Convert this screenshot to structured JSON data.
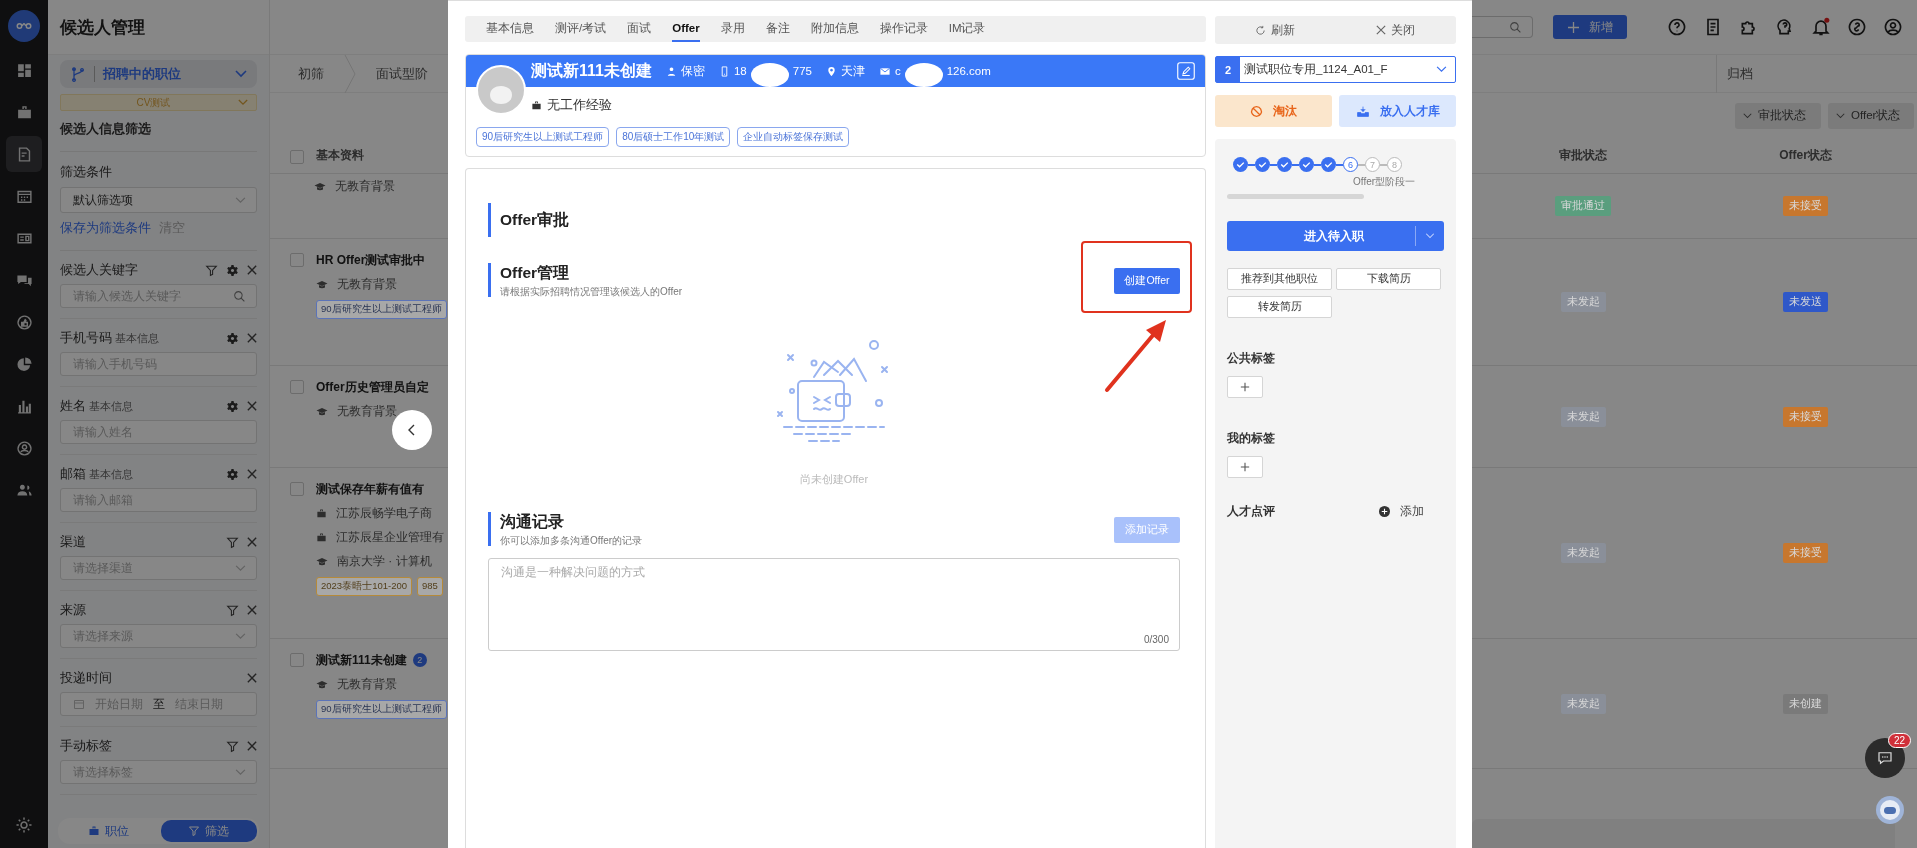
{
  "nav_rail": {
    "items": [
      {
        "selected": false
      },
      {
        "selected": false
      },
      {
        "selected": true
      },
      {
        "selected": false
      },
      {
        "selected": false
      },
      {
        "selected": false
      },
      {
        "selected": false
      },
      {
        "selected": false
      },
      {
        "selected": false
      },
      {
        "selected": false
      },
      {
        "selected": false
      }
    ]
  },
  "filter_panel": {
    "title": "候选人管理",
    "job_selector": "招聘中的职位",
    "job_tag": "CV测试",
    "section_title": "候选人信息筛选",
    "preset_label": "筛选条件",
    "preset_value": "默认筛选项",
    "save_link": "保存为筛选条件",
    "clear_link": "清空",
    "fields": [
      {
        "kind": "search",
        "label": "候选人关键字",
        "filter": true,
        "settings": true,
        "placeholder": "请输入候选人关键字"
      },
      {
        "kind": "text",
        "label": "手机号码",
        "note": "基本信息",
        "filter": false,
        "settings": true,
        "placeholder": "请输入手机号码"
      },
      {
        "kind": "text",
        "label": "姓名",
        "note": "基本信息",
        "filter": false,
        "settings": true,
        "placeholder": "请输入姓名"
      },
      {
        "kind": "text",
        "label": "邮箱",
        "note": "基本信息",
        "filter": false,
        "settings": true,
        "placeholder": "请输入邮箱"
      },
      {
        "kind": "select",
        "label": "渠道",
        "filter": true,
        "settings": false,
        "placeholder": "请选择渠道"
      },
      {
        "kind": "select",
        "label": "来源",
        "filter": true,
        "settings": false,
        "placeholder": "请选择来源"
      },
      {
        "kind": "daterange",
        "label": "投递时间",
        "filter": false,
        "settings": false,
        "start_placeholder": "开始日期",
        "separator": "至",
        "end_placeholder": "结束日期"
      },
      {
        "kind": "select",
        "label": "手动标签",
        "filter": true,
        "settings": false,
        "placeholder": "请选择标签"
      }
    ],
    "footer_tabs": [
      {
        "label": "职位",
        "selected": false
      },
      {
        "label": "筛选",
        "selected": true
      }
    ]
  },
  "top_bar": {
    "new_button": "新增",
    "notification_dot": true
  },
  "stage_bar": {
    "stages": [
      "初筛",
      "面试型阶"
    ],
    "archive": "归档"
  },
  "column_filters": [
    "审批状态",
    "Offer状态"
  ],
  "table": {
    "select_all_checked": false,
    "columns": {
      "profile": "基本资料",
      "approval": "审批状态",
      "offer": "Offer状态"
    },
    "rows": [
      {
        "lines": [
          {
            "kind": "education",
            "text": "无教育背景"
          }
        ],
        "approval": {
          "text": "审批通过",
          "color": "#5a9e7e"
        },
        "offer": {
          "text": "未接受",
          "color": "#c7772e"
        }
      },
      {
        "name": "HR Offer测试审批中",
        "checked": false,
        "lines": [
          {
            "kind": "education",
            "text": "无教育背景"
          }
        ],
        "tags": [
          {
            "text": "90后研究生以上测试工程师",
            "color": "#5b73b8"
          }
        ],
        "approval": {
          "text": "未发起",
          "color": "#8a8f99"
        },
        "offer": {
          "text": "未发送",
          "color": "#2f58c8"
        }
      },
      {
        "name": "Offer历史管理员自定",
        "checked": false,
        "lines": [
          {
            "kind": "education",
            "text": "无教育背景"
          }
        ],
        "approval": {
          "text": "未发起",
          "color": "#8a8f99"
        },
        "offer": {
          "text": "未接受",
          "color": "#c7772e"
        }
      },
      {
        "name": "测试保存年薪有值有",
        "checked": false,
        "lines": [
          {
            "kind": "company",
            "text": "江苏辰畅学电子商"
          },
          {
            "kind": "company",
            "text": "江苏辰星企业管理有"
          },
          {
            "kind": "education",
            "text": "南京大学 · 计算机"
          }
        ],
        "tags": [
          {
            "text": "2023泰晤士101-200",
            "color": "#b58a3a"
          },
          {
            "text": "985",
            "color": "#b58a3a"
          }
        ],
        "approval": {
          "text": "未发起",
          "color": "#8a8f99"
        },
        "offer": {
          "text": "未接受",
          "color": "#c7772e"
        }
      },
      {
        "name": "测试新111未创建",
        "checked": false,
        "count": "2",
        "lines": [
          {
            "kind": "education",
            "text": "无教育背景"
          }
        ],
        "tags": [
          {
            "text": "90后研究生以上测试工程师",
            "color": "#5b73b8"
          }
        ],
        "approval": {
          "text": "未发起",
          "color": "#8a8f99"
        },
        "offer": {
          "text": "未创建",
          "color": "#7a7a7a"
        }
      }
    ]
  },
  "modal": {
    "tabs": [
      {
        "label": "基本信息",
        "selected": false
      },
      {
        "label": "测评/考试",
        "selected": false
      },
      {
        "label": "面试",
        "selected": false
      },
      {
        "label": "Offer",
        "selected": true
      },
      {
        "label": "录用",
        "selected": false
      },
      {
        "label": "备注",
        "selected": false
      },
      {
        "label": "附加信息",
        "selected": false
      },
      {
        "label": "操作记录",
        "selected": false
      },
      {
        "label": "IM记录",
        "selected": false
      }
    ],
    "profile": {
      "name": "测试新111未创建",
      "gender": "保密",
      "phone_start": "18",
      "phone_end": "775",
      "city": "天津",
      "email_start": "c",
      "email_end": "126.com",
      "experience": "无工作经验",
      "tags": [
        "90后研究生以上测试工程师",
        "80后硕士工作10年测试",
        "企业自动标签保存测试"
      ]
    },
    "offer": {
      "approval_title": "Offer审批",
      "manage_title": "Offer管理",
      "manage_hint": "请根据实际招聘情况管理该候选人的Offer",
      "create_button": "创建Offer",
      "highlighted": true,
      "empty_text": "尚未创建Offer"
    },
    "communication": {
      "title": "沟通记录",
      "hint": "你可以添加多条沟通Offer的记录",
      "add_button": "添加记录",
      "add_disabled": true,
      "placeholder": "沟通是一种解决问题的方式",
      "counter": "0/300"
    },
    "side": {
      "refresh": "刷新",
      "close": "关闭",
      "job_index": "2",
      "job_value": "测试职位专用_1124_A01_F",
      "reject": "淘汰",
      "talent_pool": "放入人才库",
      "steps": [
        {
          "kind": "done"
        },
        {
          "kind": "done"
        },
        {
          "kind": "done"
        },
        {
          "kind": "done"
        },
        {
          "kind": "done"
        },
        {
          "kind": "current",
          "number": "6"
        },
        {
          "kind": "pending",
          "number": "7"
        },
        {
          "kind": "pending",
          "number": "8"
        }
      ],
      "stage_label": "Offer型阶段一",
      "primary": "进入待入职",
      "actions": [
        "推荐到其他职位",
        "下载简历",
        "转发简历"
      ],
      "public_tags": "公共标签",
      "my_tags": "我的标签",
      "review": "人才点评",
      "review_add": "添加"
    }
  },
  "chat_count": "22"
}
